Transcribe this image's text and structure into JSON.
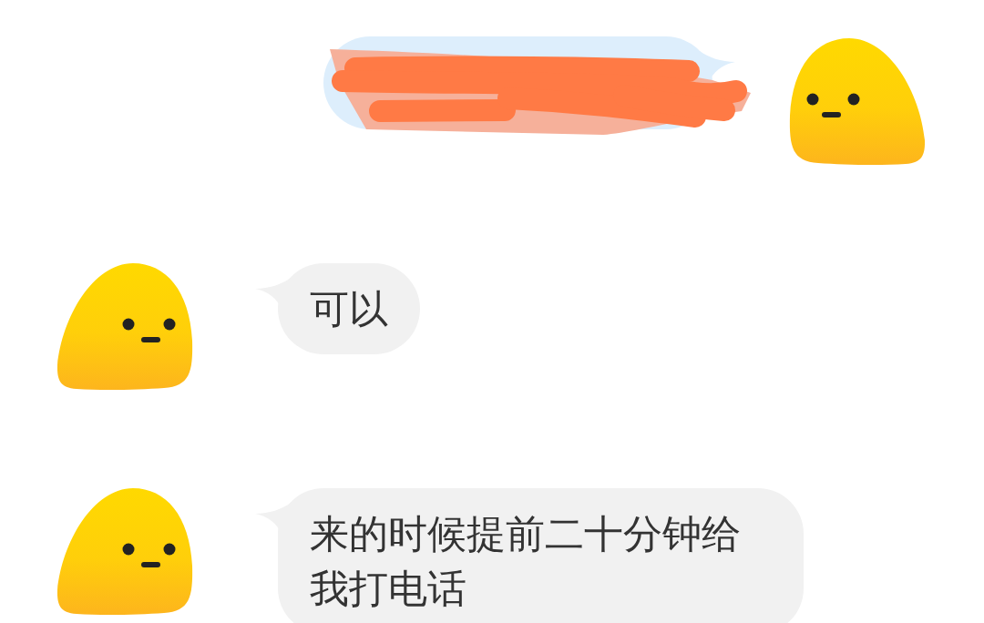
{
  "messages": [
    {
      "outgoing": true,
      "kind": "redacted"
    },
    {
      "outgoing": false,
      "kind": "text",
      "text": "可以"
    },
    {
      "outgoing": false,
      "kind": "text",
      "text": "来的时候提前二十分钟给我打电话"
    }
  ]
}
